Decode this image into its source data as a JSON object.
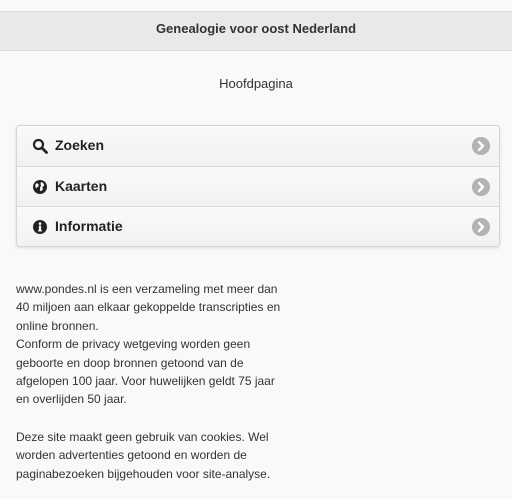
{
  "header": {
    "title": "Genealogie voor oost Nederland"
  },
  "page": {
    "subtitle": "Hoofdpagina"
  },
  "menu": {
    "items": [
      {
        "label": "Zoeken",
        "icon": "search-icon"
      },
      {
        "label": "Kaarten",
        "icon": "globe-icon"
      },
      {
        "label": "Informatie",
        "icon": "info-icon"
      }
    ],
    "chevron_icon": "chevron-right-circle-icon"
  },
  "content": {
    "paragraph1": [
      "www.pondes.nl is een verzameling met meer dan",
      "40 miljoen aan elkaar gekoppelde transcripties en",
      "online bronnen.",
      "Conform de privacy wetgeving worden geen",
      "geboorte en doop bronnen getoond van de",
      "afgelopen 100 jaar. Voor huwelijken geldt 75 jaar",
      "en overlijden 50 jaar."
    ],
    "paragraph2": [
      "Deze site maakt geen gebruik van cookies. Wel",
      "worden advertenties getoond en worden de",
      "paginabezoeken bijgehouden voor site-analyse."
    ]
  },
  "colors": {
    "header_bg": "#e9e9e9",
    "chevron": "#b3b3b3",
    "text": "#333333"
  }
}
